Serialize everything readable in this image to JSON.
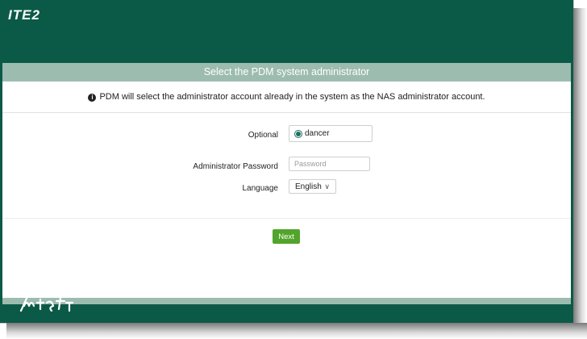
{
  "brand": {
    "logo_text": "ITE2"
  },
  "card": {
    "header": "Select the PDM system administrator",
    "info_text": "PDM will select the administrator account already in the system as the NAS administrator account."
  },
  "form": {
    "optional_label": "Optional",
    "optional_value": "dancer",
    "password_label": "Administrator Password",
    "password_placeholder": "Password",
    "language_label": "Language",
    "language_value": "English"
  },
  "actions": {
    "next_label": "Next"
  },
  "colors": {
    "brand_green": "#0b5a47",
    "header_band": "#9dbcb0",
    "button_green": "#52a52b"
  },
  "icons": {
    "info": "info-circle-icon",
    "dropdown": "chevron-down-icon"
  }
}
